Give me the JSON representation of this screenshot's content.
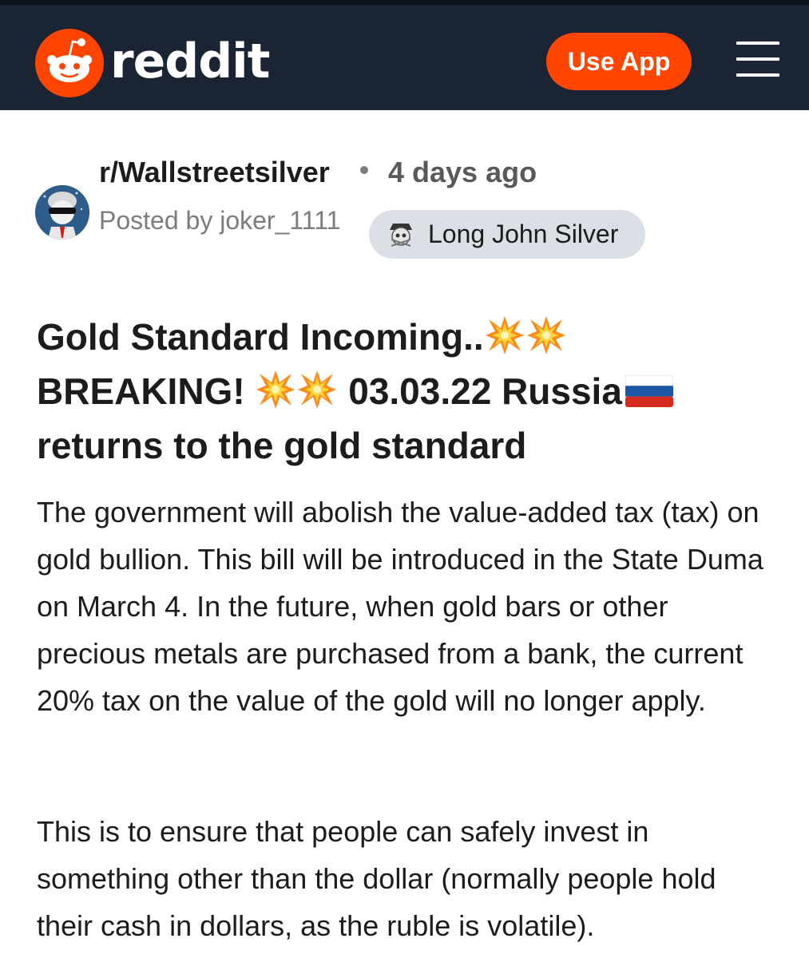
{
  "header": {
    "brand": "reddit",
    "use_app_label": "Use App",
    "logo_icon": "reddit-snoo-icon",
    "menu_icon": "hamburger-menu-icon",
    "brand_color": "#ff4500",
    "bar_color": "#1b2433"
  },
  "post": {
    "subreddit": "r/Wallstreetsilver",
    "separator": "•",
    "time": "4 days ago",
    "posted_by": "Posted by joker_1111",
    "flair": "Long John Silver",
    "title_part1": "Gold Standard Incoming..",
    "title_part2": "BREAKING!",
    "title_part3": "03.03.22 Russia",
    "title_part4": "returns to the gold standard",
    "body": [
      "The government will abolish the value-added tax (tax) on gold bullion. This bill will be introduced in the State Duma on March 4. In the future, when gold bars or other precious metals are purchased from a bank, the current 20% tax on the value of the gold will no longer apply.",
      "This is to ensure that people can safely invest in something other than the dollar (normally people hold their cash in dollars, as the ruble is volatile)."
    ]
  }
}
